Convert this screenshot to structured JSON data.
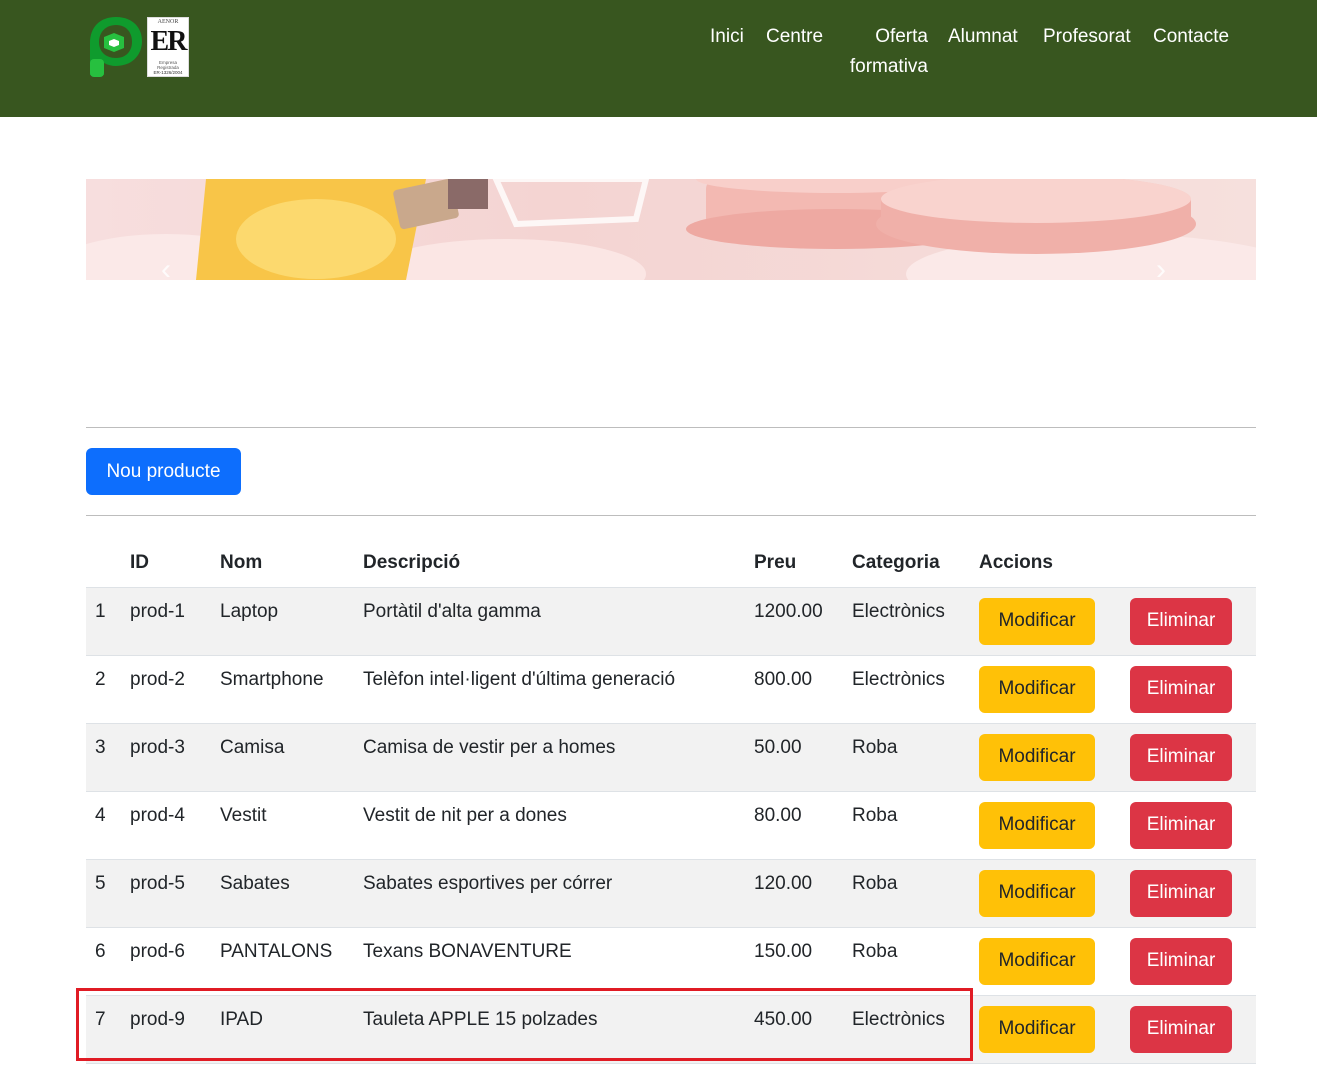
{
  "header": {
    "nav": [
      {
        "label": "Inici"
      },
      {
        "label": "Centre"
      },
      {
        "label": "Oferta formativa"
      },
      {
        "label": "Alumnat"
      },
      {
        "label": "Profesorat"
      },
      {
        "label": "Contacte"
      }
    ],
    "certificate": {
      "brand": "AENOR",
      "mark": "ER",
      "text": "Empresa Registrada",
      "number": "ER-1326/2004"
    }
  },
  "banner": {
    "prev_icon": "chevron-left-icon",
    "next_icon": "chevron-right-icon"
  },
  "toolbar": {
    "new_label": "Nou producte"
  },
  "table": {
    "headers": [
      "",
      "ID",
      "Nom",
      "Descripció",
      "Preu",
      "Categoria",
      "Accions"
    ],
    "modify_label": "Modificar",
    "delete_label": "Eliminar",
    "rows": [
      {
        "idx": "1",
        "id": "prod-1",
        "nom": "Laptop",
        "desc": "Portàtil d'alta gamma",
        "preu": "1200.00",
        "cat": "Electrònics"
      },
      {
        "idx": "2",
        "id": "prod-2",
        "nom": "Smartphone",
        "desc": "Telèfon intel·ligent d'última generació",
        "preu": "800.00",
        "cat": "Electrònics"
      },
      {
        "idx": "3",
        "id": "prod-3",
        "nom": "Camisa",
        "desc": "Camisa de vestir per a homes",
        "preu": "50.00",
        "cat": "Roba"
      },
      {
        "idx": "4",
        "id": "prod-4",
        "nom": "Vestit",
        "desc": "Vestit de nit per a dones",
        "preu": "80.00",
        "cat": "Roba"
      },
      {
        "idx": "5",
        "id": "prod-5",
        "nom": "Sabates",
        "desc": "Sabates esportives per córrer",
        "preu": "120.00",
        "cat": "Roba"
      },
      {
        "idx": "6",
        "id": "prod-6",
        "nom": "PANTALONS",
        "desc": "Texans BONAVENTURE",
        "preu": "150.00",
        "cat": "Roba"
      },
      {
        "idx": "7",
        "id": "prod-9",
        "nom": "IPAD",
        "desc": "Tauleta APPLE 15 polzades",
        "preu": "450.00",
        "cat": "Electrònics"
      }
    ]
  },
  "colors": {
    "header_bg": "#38561f",
    "primary": "#0d6efd",
    "warning": "#ffc107",
    "danger": "#dc3545",
    "highlight": "#e01b24"
  }
}
